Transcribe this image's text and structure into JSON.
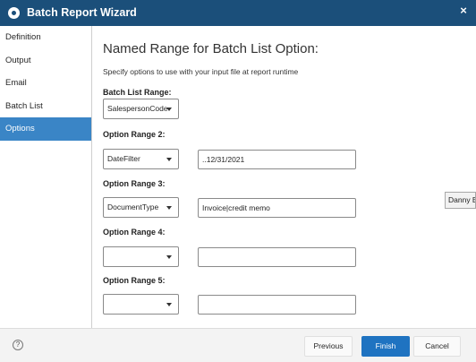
{
  "window": {
    "title": "Batch Report Wizard",
    "close_glyph": "×",
    "icon": "app-logo-icon"
  },
  "sidebar": {
    "items": [
      {
        "label": "Definition"
      },
      {
        "label": "Output"
      },
      {
        "label": "Email"
      },
      {
        "label": "Batch List"
      },
      {
        "label": "Options"
      }
    ],
    "active": "Options"
  },
  "main": {
    "heading": "Named Range for Batch List Option:",
    "description": "Specify options to use with your input file at report runtime",
    "batch_list_range": {
      "label": "Batch List Range:",
      "value": "SalespersonCode"
    },
    "option_ranges": [
      {
        "label": "Option Range 2:",
        "select": "DateFilter",
        "text": "..12/31/2021"
      },
      {
        "label": "Option Range 3:",
        "select": "DocumentType",
        "text": "Invoice|credit memo"
      },
      {
        "label": "Option Range 4:",
        "select": "",
        "text": ""
      },
      {
        "label": "Option Range 5:",
        "select": "",
        "text": ""
      }
    ]
  },
  "footer": {
    "help_glyph": "?",
    "previous_label": "Previous",
    "finish_label": "Finish",
    "cancel_label": "Cancel"
  },
  "tooltip": {
    "text": "Danny B"
  },
  "colors": {
    "titlebar": "#1b4f7a",
    "active_item": "#3a85c6",
    "primary_button": "#1f73c1"
  }
}
